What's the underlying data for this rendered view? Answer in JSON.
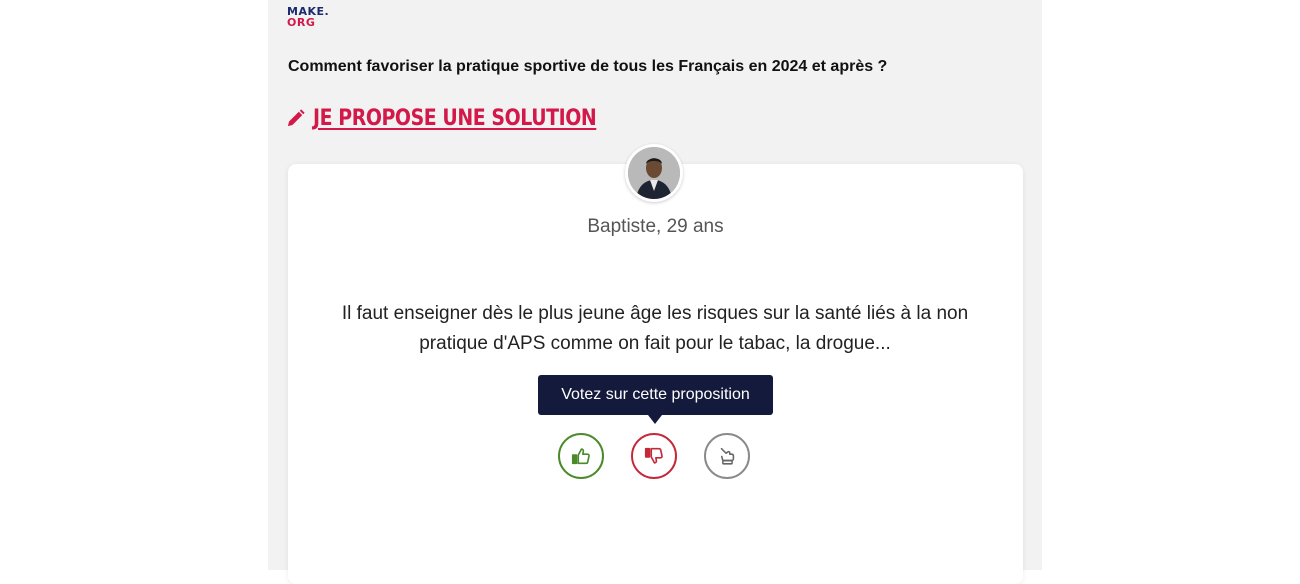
{
  "logo": {
    "line1_make": "MAKE",
    "line1_dot": ".",
    "line2": "ORG"
  },
  "question": "Comment favoriser la pratique sportive de tous les Français en 2024 et après ?",
  "propose": {
    "label": "JE PROPOSE UNE SOLUTION"
  },
  "proposal": {
    "author": "Baptiste, 29 ans",
    "text": "Il faut enseigner dès le plus jeune âge les risques sur la santé liés à la non pratique d'APS comme on fait pour le tabac, la drogue..."
  },
  "vote": {
    "tooltip": "Votez sur cette proposition",
    "buttons": [
      {
        "name": "agree",
        "icon": "thumbs-up-icon",
        "color": "#4a8a2c"
      },
      {
        "name": "disagree",
        "icon": "thumbs-down-icon",
        "color": "#c4293a"
      },
      {
        "name": "neutral",
        "icon": "hand-neutral-icon",
        "color": "#8a8a8a"
      }
    ]
  },
  "colors": {
    "brand_red": "#d3184a",
    "brand_navy": "#1a2a6c",
    "tooltip_bg": "#141a3c"
  }
}
